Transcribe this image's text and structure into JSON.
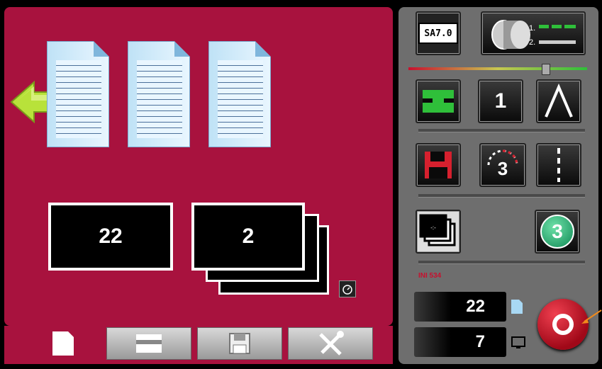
{
  "main": {
    "counter_left": "22",
    "counter_right": "2"
  },
  "tabs": [
    {
      "name": "page-icon",
      "active": true
    },
    {
      "name": "stacker-icon",
      "active": false
    },
    {
      "name": "save-icon",
      "active": false
    },
    {
      "name": "tools-icon",
      "active": false
    }
  ],
  "right": {
    "display_text": "SA7.0",
    "row2_number": "1",
    "timer_number": "3",
    "badge_number": "3",
    "small_label": "INI 534",
    "field_pages": "22",
    "field_sets": "7",
    "slider_level": 0.8
  },
  "colors": {
    "panel_red": "#a8123e",
    "panel_gray": "#6e6e6e",
    "accent_green": "#2fbf3a",
    "stop_red": "#c8102e"
  }
}
